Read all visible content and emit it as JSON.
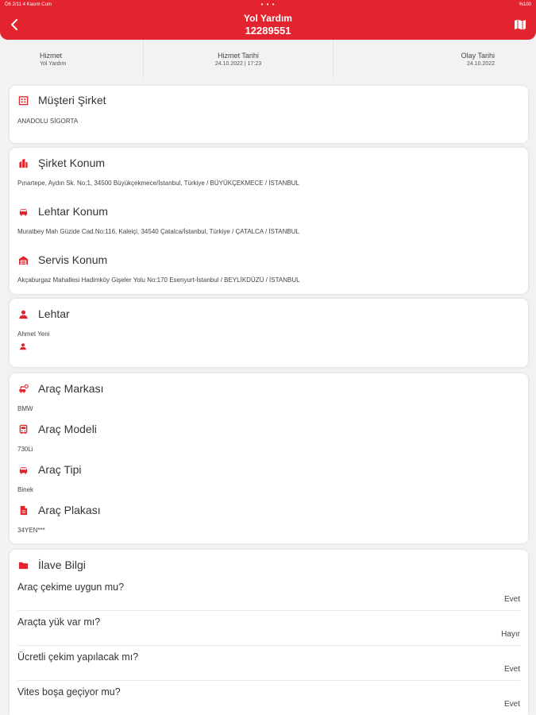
{
  "status_bar": {
    "left": "Ö6 2/11   4 Kasım Cum",
    "center": "• • •",
    "right": "%100"
  },
  "header": {
    "title": "Yol Yardım",
    "subtitle": "12289551"
  },
  "summary": [
    {
      "label": "Hizmet",
      "value": "Yol Yardım"
    },
    {
      "label": "Hizmet Tarihi",
      "value": "24.10.2022 | 17:23"
    },
    {
      "label": "Olay Tarihi",
      "value": "24.10.2022"
    }
  ],
  "customer": {
    "title": "Müşteri Şirket",
    "value": "ANADOLU SİGORTA"
  },
  "locations": [
    {
      "title": "Şirket Konum",
      "value": "Pınartepe, Aydın Sk. No:1, 34500 Büyükçekmece/İstanbul, Türkiye / BÜYÜKÇEKMECE / İSTANBUL"
    },
    {
      "title": "Lehtar Konum",
      "value": "Muratbey Mah Güzide Cad.No:116, Kaleiçi, 34540 Çatalca/İstanbul, Türkiye / ÇATALCA / İSTANBUL"
    },
    {
      "title": "Servis Konum",
      "value": "Akçaburgaz Mahallesi Hadimköy Gişeler Yolu No:170 Esenyurt-İstanbul / BEYLİKDÜZÜ / İSTANBUL"
    }
  ],
  "beneficiary": {
    "title": "Lehtar",
    "value": "Ahmet  Yeni"
  },
  "vehicle": [
    {
      "title": "Araç Markası",
      "value": "BMW"
    },
    {
      "title": "Araç Modeli",
      "value": "730Li"
    },
    {
      "title": "Araç Tipi",
      "value": "Binek"
    },
    {
      "title": "Araç Plakası",
      "value": "34YEN***"
    }
  ],
  "extra": {
    "title": "İlave Bilgi",
    "items": [
      {
        "question": "Araç çekime uygun mu?",
        "answer": "Evet"
      },
      {
        "question": "Araçta yük var mı?",
        "answer": "Hayır"
      },
      {
        "question": "Ücretli çekim yapılacak mı?",
        "answer": "Evet"
      },
      {
        "question": "Vites boşa geçiyor mu?",
        "answer": "Evet"
      }
    ]
  },
  "colors": {
    "accent": "#e3232e",
    "background": "#f2f2f2",
    "card": "#ffffff"
  }
}
